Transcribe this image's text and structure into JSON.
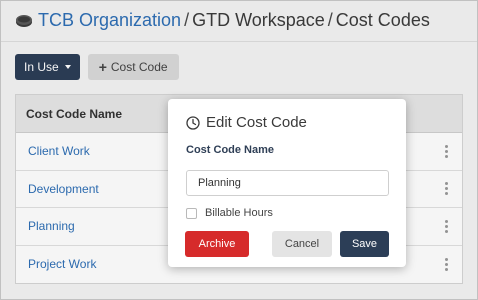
{
  "breadcrumb": {
    "organization": "TCB Organization",
    "separator": "/",
    "workspace": "GTD Workspace",
    "page": "Cost Codes",
    "org_icon": "organization-disc-icon"
  },
  "toolbar": {
    "filter_label": "In Use",
    "add_label": "Cost Code"
  },
  "table": {
    "header": "Cost Code Name",
    "rows": [
      "Client Work",
      "Development",
      "Planning",
      "Project Work"
    ]
  },
  "modal": {
    "title": "Edit Cost Code",
    "title_icon": "clock-icon",
    "field_label": "Cost Code Name",
    "field_value": "Planning",
    "checkbox_label": "Billable Hours",
    "checkbox_checked": false,
    "archive_label": "Archive",
    "cancel_label": "Cancel",
    "save_label": "Save"
  },
  "colors": {
    "primary": "#2c3e57",
    "link": "#2e6fb6",
    "danger": "#d62b2b"
  }
}
